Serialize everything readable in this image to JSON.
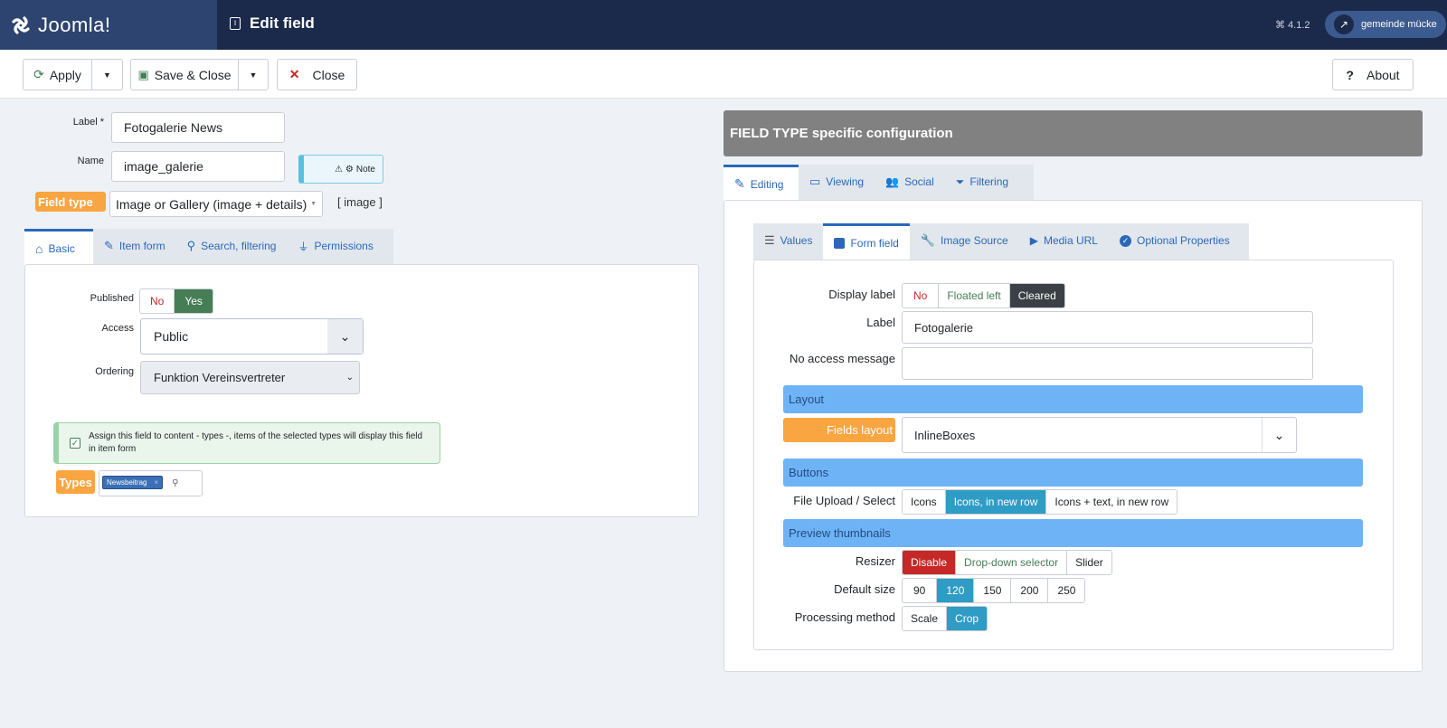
{
  "header": {
    "logo_text": "Joomla!",
    "page_title": "Edit field",
    "version": "4.1.2",
    "user": "gemeinde mücke"
  },
  "toolbar": {
    "apply": "Apply",
    "save_close": "Save & Close",
    "close": "Close",
    "about": "About"
  },
  "left": {
    "label_label": "Label *",
    "label_value": "Fotogalerie News",
    "name_label": "Name",
    "name_value": "image_galerie",
    "note_label": "Note",
    "field_type_badge": "Field type",
    "field_type_value": "Image or Gallery (image + details)",
    "field_type_code": "[ image ]",
    "tabs": [
      {
        "label": "Basic"
      },
      {
        "label": "Item form"
      },
      {
        "label": "Search, filtering"
      },
      {
        "label": "Permissions"
      }
    ],
    "published_label": "Published",
    "published_no": "No",
    "published_yes": "Yes",
    "access_label": "Access",
    "access_value": "Public",
    "ordering_label": "Ordering",
    "ordering_value": "Funktion Vereinsvertreter",
    "assign_text": "Assign this field to content - types -, items of the selected types will display this field in item form",
    "types_badge": "Types",
    "types_tag": "Newsbeitrag",
    "types_tag_remove": "×"
  },
  "right": {
    "title": "FIELD TYPE specific configuration",
    "outer_tabs": [
      {
        "label": "Editing"
      },
      {
        "label": "Viewing"
      },
      {
        "label": "Social"
      },
      {
        "label": "Filtering"
      }
    ],
    "inner_tabs": [
      {
        "label": "Values"
      },
      {
        "label": "Form field"
      },
      {
        "label": "Image Source"
      },
      {
        "label": "Media URL"
      },
      {
        "label": "Optional Properties"
      }
    ],
    "display_label": "Display label",
    "display_options": [
      "No",
      "Floated left",
      "Cleared"
    ],
    "label_label": "Label",
    "label_value": "Fotogalerie",
    "no_access_label": "No access message",
    "no_access_value": "",
    "layout_section": "Layout",
    "fields_layout_badge": "Fields layout",
    "fields_layout_value": "InlineBoxes",
    "buttons_section": "Buttons",
    "file_upload_label": "File Upload / Select",
    "file_upload_options": [
      "Icons",
      "Icons, in new row",
      "Icons + text, in new row"
    ],
    "preview_section": "Preview thumbnails",
    "resizer_label": "Resizer",
    "resizer_options": [
      "Disable",
      "Drop-down selector",
      "Slider"
    ],
    "default_size_label": "Default size",
    "default_size_options": [
      "90",
      "120",
      "150",
      "200",
      "250"
    ],
    "processing_label": "Processing method",
    "processing_options": [
      "Scale",
      "Crop"
    ]
  },
  "colors": {
    "header": "#1b2a4a",
    "accent": "#2a69b8",
    "badge": "#f9a541",
    "section": "#6fb3f7",
    "active_teal": "#2f9cc5",
    "danger": "#c52827",
    "success": "#457d54"
  }
}
